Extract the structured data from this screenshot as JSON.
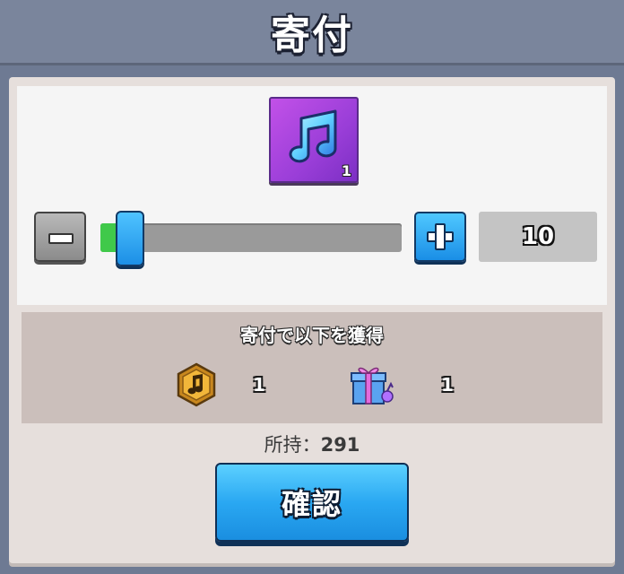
{
  "header": {
    "title": "寄付"
  },
  "item": {
    "icon": "music-note-icon",
    "count": "1",
    "card_color": "#a845dd"
  },
  "slider": {
    "value": 10,
    "min": 1,
    "max": 100,
    "fraction": 0.06
  },
  "quantity": {
    "value": "10"
  },
  "reward": {
    "title": "寄付で以下を獲得",
    "items": [
      {
        "icon": "gold-music-medal-icon",
        "value": "1"
      },
      {
        "icon": "gift-box-icon",
        "value": "1"
      }
    ]
  },
  "owned": {
    "label": "所持：",
    "value": "291"
  },
  "confirm": {
    "label": "確認"
  },
  "colors": {
    "accent": "#2aa8f2",
    "panel": "#e6dfdc",
    "header": "#7a859c"
  }
}
